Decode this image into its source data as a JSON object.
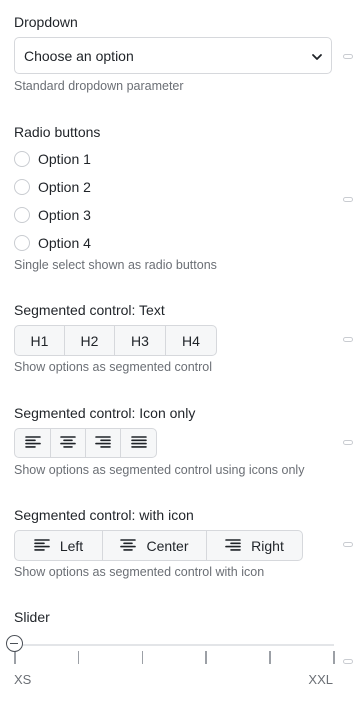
{
  "dropdown": {
    "label": "Dropdown",
    "value": "Choose an option",
    "help": "Standard dropdown parameter"
  },
  "radio": {
    "label": "Radio buttons",
    "options": [
      "Option 1",
      "Option 2",
      "Option 3",
      "Option 4"
    ],
    "help": "Single select shown as radio buttons"
  },
  "seg_text": {
    "label": "Segmented control: Text",
    "options": [
      "H1",
      "H2",
      "H3",
      "H4"
    ],
    "help": "Show options as segmented control"
  },
  "seg_icon": {
    "label": "Segmented control: Icon only",
    "icons": [
      "align-left-icon",
      "align-center-icon",
      "align-right-icon",
      "align-justify-icon"
    ],
    "help": "Show options as segmented control using icons only"
  },
  "seg_with_icon": {
    "label": "Segmented control: with icon",
    "options": [
      {
        "label": "Left",
        "icon": "align-left-icon"
      },
      {
        "label": "Center",
        "icon": "align-center-icon"
      },
      {
        "label": "Right",
        "icon": "align-right-icon"
      }
    ],
    "help": "Show options as segmented control with icon"
  },
  "slider": {
    "label": "Slider",
    "min_label": "XS",
    "max_label": "XXL",
    "steps": 6,
    "value_index": 0
  }
}
